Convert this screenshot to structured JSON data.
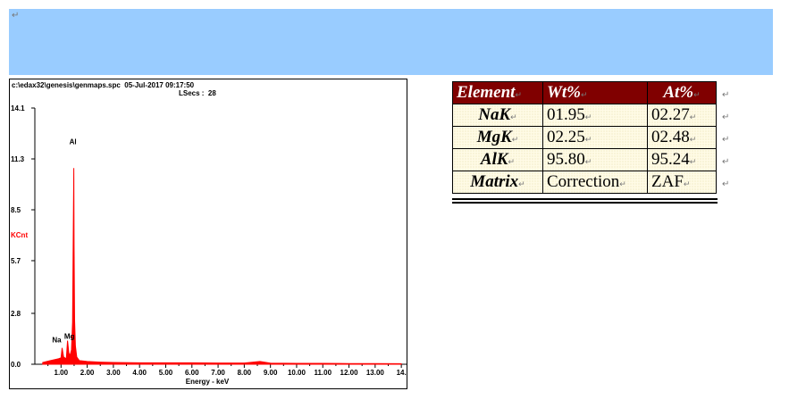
{
  "para_mark": "↵",
  "table_row_marks": [
    "↵",
    "↵",
    "↵",
    "↵",
    "↵"
  ],
  "spectrum": {
    "header_line1": "c:\\edax32\\genesis\\genmaps.spc  05-Jul-2017 09:17:50",
    "header_line2": "LSecs :  28",
    "y_axis_label": "KCnt",
    "x_axis_label": "Energy - keV",
    "y_tick_labels": [
      "14.1",
      "11.3",
      "8.5",
      "5.7",
      "2.8",
      "0.0"
    ],
    "x_tick_labels": [
      "1.00",
      "2.00",
      "3.00",
      "4.00",
      "5.00",
      "6.00",
      "7.00",
      "8.00",
      "9.00",
      "10.00",
      "11.00",
      "12.00",
      "13.00",
      "14."
    ],
    "peak_labels": [
      "Al",
      "Mg",
      "Na"
    ],
    "colors": {
      "spectrum": "#ff0000",
      "ylabel": "#ff0000"
    }
  },
  "chart_data": {
    "type": "line",
    "xlabel": "Energy - keV",
    "ylabel": "KCnt",
    "xlim": [
      0,
      14.2
    ],
    "ylim": [
      0,
      14.1
    ],
    "y_ticks": [
      0.0,
      2.8,
      5.7,
      8.5,
      11.3,
      14.1
    ],
    "x_ticks": [
      1,
      2,
      3,
      4,
      5,
      6,
      7,
      8,
      9,
      10,
      11,
      12,
      13,
      14
    ],
    "series": [
      {
        "x": [
          0.3,
          0.6,
          0.9,
          1.0,
          1.04,
          1.1,
          1.2,
          1.25,
          1.3,
          1.35,
          1.4,
          1.44,
          1.46,
          1.487,
          1.5,
          1.52,
          1.55,
          1.6,
          1.7,
          2.0,
          2.5,
          3.0,
          4.0,
          5.0,
          6.0,
          7.0,
          8.0,
          8.6,
          9.0,
          10.0,
          11.0,
          12.0,
          13.0,
          14.0
        ],
        "values": [
          0.1,
          0.2,
          0.3,
          0.35,
          0.9,
          0.4,
          0.3,
          1.3,
          0.6,
          0.5,
          0.8,
          2.3,
          6.0,
          10.8,
          6.5,
          2.4,
          1.0,
          0.4,
          0.2,
          0.15,
          0.12,
          0.1,
          0.08,
          0.08,
          0.08,
          0.07,
          0.07,
          0.15,
          0.06,
          0.05,
          0.05,
          0.04,
          0.04,
          0.03
        ]
      }
    ],
    "annotations": [
      {
        "text": "Al",
        "x": 1.49,
        "y": 12.1
      },
      {
        "text": "Mg",
        "x": 1.25,
        "y": 1.4
      },
      {
        "text": "Na",
        "x": 1.04,
        "y": 0.9
      }
    ]
  },
  "table": {
    "headers": [
      "Element",
      "Wt%",
      "At%"
    ],
    "rows": [
      [
        "NaK",
        "01.95",
        "02.27"
      ],
      [
        "MgK",
        "02.25",
        "02.48"
      ],
      [
        "AlK",
        "95.80",
        "95.24"
      ],
      [
        "Matrix",
        "Correction",
        "ZAF"
      ]
    ],
    "cell_mark": "↵",
    "colors": {
      "header_bg": "#800000",
      "header_text": "#ffffff",
      "cell_bg": "#fffbe6"
    }
  },
  "colors": {
    "banner": "#99ccff"
  }
}
